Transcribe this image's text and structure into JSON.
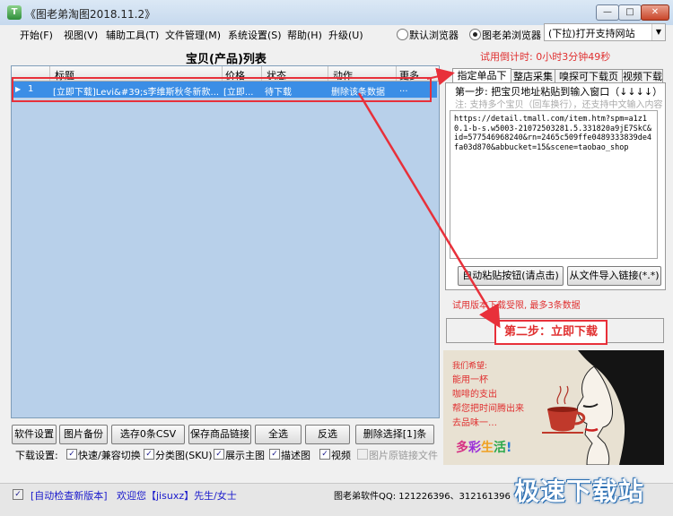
{
  "window": {
    "title": "《图老弟淘图2018.11.2》",
    "icon_text": "T"
  },
  "menu": {
    "items": [
      "开始(F)",
      "视图(V)",
      "辅助工具(T)",
      "文件管理(M)",
      "系统设置(S)",
      "帮助(H)",
      "升级(U)"
    ],
    "browser_default": "默认浏览器",
    "browser_app": "图老弟浏览器",
    "dropdown_value": "(下拉)打开支持网站"
  },
  "list": {
    "title": "宝贝(产品)列表",
    "columns": [
      "标题",
      "价格",
      "状态",
      "动作",
      "更多"
    ],
    "rows": [
      {
        "num": "1",
        "title": "[立即下载]Levi&#39;s李维斯秋冬新款...",
        "price": "[立即...",
        "status": "待下载",
        "action": "删除该条数据",
        "more": "..."
      }
    ]
  },
  "buttons": {
    "row1": [
      "软件设置",
      "图片备份",
      "选存0条CSV",
      "保存商品链接",
      "全选",
      "反选",
      "删除选择[1]条"
    ]
  },
  "download_settings": {
    "label": "下载设置:",
    "options": [
      {
        "label": "快速/兼容切换",
        "checked": true
      },
      {
        "label": "分类图(SKU)",
        "checked": true
      },
      {
        "label": "展示主图",
        "checked": true
      },
      {
        "label": "描述图",
        "checked": true
      },
      {
        "label": "视频",
        "checked": true
      },
      {
        "label": "图片原链接文件",
        "checked": false
      }
    ]
  },
  "right": {
    "trial_countdown": "试用倒计时: 0小时3分钟49秒",
    "tabs": [
      "指定单品下载",
      "整店采集",
      "嗅探可下载页面",
      "视频下载"
    ],
    "step1": "第一步: 把宝贝地址粘贴到输入窗口（↓↓↓↓）",
    "note": "注: 支持多个宝贝（回车换行），还支持中文输入内容",
    "url_text": "https://detail.tmall.com/item.htm?spm=a1z10.1-b-s.w5003-21072503281.5.331820a9jE7SkC&id=577546968240&rn=2465c509ffe0489333839de4fa03d870&abbucket=15&scene=taobao_shop",
    "auto_paste_button": "自动粘贴按钮(请点击)",
    "import_button": "从文件导入链接(*.*)",
    "limit_text": "试用版本下载受限, 最多3条数据",
    "step2_button": "第二步：立即下载"
  },
  "ad": {
    "lines": [
      "我们希望:",
      "能用一杯",
      "咖啡的支出",
      "帮您把时间腾出来",
      "去品味一…"
    ],
    "colorful": [
      "多",
      "彩",
      "生",
      "活",
      "!"
    ]
  },
  "status": {
    "auto_check": "[自动检查新版本]",
    "welcome": "欢迎您【jisuxz】先生/女士",
    "qq": "图老弟软件QQ: 121226396、312161396",
    "watermark": "极速下载站"
  },
  "colors": {
    "accent_red": "#e8303a",
    "selection_blue": "#3b8ee6",
    "grid_bg": "#b8d0ea"
  }
}
